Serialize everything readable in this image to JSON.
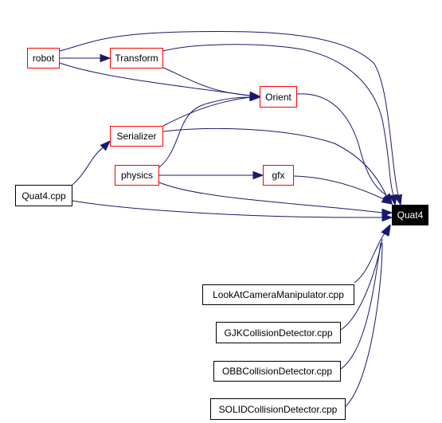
{
  "diagram": {
    "type": "include-dependency-graph",
    "colors": {
      "edge": "#191970",
      "documented_border": "#ff0000",
      "file_border": "#000000",
      "focus_fill": "#000000",
      "focus_text": "#ffffff"
    },
    "nodes": {
      "robot": {
        "label": "robot",
        "kind": "documented"
      },
      "transform": {
        "label": "Transform",
        "kind": "documented"
      },
      "orient": {
        "label": "Orient",
        "kind": "documented"
      },
      "serializer": {
        "label": "Serializer",
        "kind": "documented"
      },
      "physics": {
        "label": "physics",
        "kind": "documented"
      },
      "gfx": {
        "label": "gfx",
        "kind": "documented"
      },
      "quat4cpp": {
        "label": "Quat4.cpp",
        "kind": "file"
      },
      "quat4": {
        "label": "Quat4",
        "kind": "focus"
      },
      "lookat": {
        "label": "LookAtCameraManipulator.cpp",
        "kind": "file"
      },
      "gjk": {
        "label": "GJKCollisionDetector.cpp",
        "kind": "file"
      },
      "obb": {
        "label": "OBBCollisionDetector.cpp",
        "kind": "file"
      },
      "solid": {
        "label": "SOLIDCollisionDetector.cpp",
        "kind": "file"
      }
    },
    "edges": [
      {
        "from": "robot",
        "to": "transform"
      },
      {
        "from": "robot",
        "to": "orient"
      },
      {
        "from": "robot",
        "to": "quat4"
      },
      {
        "from": "transform",
        "to": "orient"
      },
      {
        "from": "transform",
        "to": "quat4"
      },
      {
        "from": "orient",
        "to": "quat4"
      },
      {
        "from": "serializer",
        "to": "orient"
      },
      {
        "from": "serializer",
        "to": "quat4"
      },
      {
        "from": "physics",
        "to": "orient"
      },
      {
        "from": "physics",
        "to": "gfx"
      },
      {
        "from": "physics",
        "to": "quat4"
      },
      {
        "from": "gfx",
        "to": "quat4"
      },
      {
        "from": "quat4cpp",
        "to": "serializer"
      },
      {
        "from": "quat4cpp",
        "to": "quat4"
      },
      {
        "from": "lookat",
        "to": "quat4"
      },
      {
        "from": "gjk",
        "to": "quat4"
      },
      {
        "from": "obb",
        "to": "quat4"
      },
      {
        "from": "solid",
        "to": "quat4"
      }
    ]
  }
}
